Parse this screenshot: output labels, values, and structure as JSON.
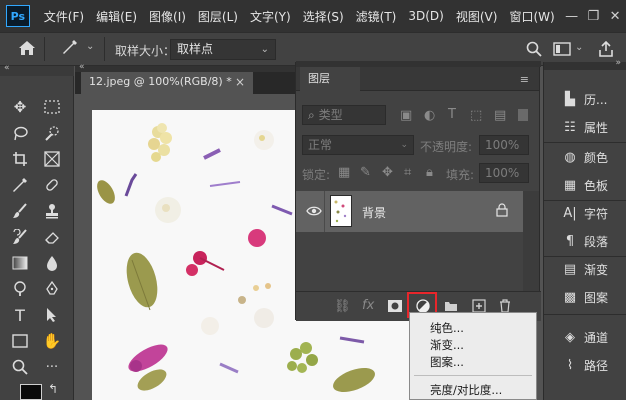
{
  "app": {
    "logo": "Ps",
    "menu": [
      "文件(F)",
      "编辑(E)",
      "图像(I)",
      "图层(L)",
      "文字(Y)",
      "选择(S)",
      "滤镜(T)",
      "3D(D)",
      "视图(V)",
      "窗口(W)"
    ],
    "window_controls": [
      "—",
      "❐",
      "✕"
    ]
  },
  "options": {
    "home_icon": "home-icon",
    "sample_size_label": "取样大小：",
    "sample_size_value": "取样点"
  },
  "document": {
    "tab_title": "12.jpeg @ 100%(RGB/8) *",
    "close": "×"
  },
  "layers_panel": {
    "title": "图层",
    "filter_label": "类型",
    "blend_mode": "正常",
    "opacity_label": "不透明度:",
    "opacity_value": "100%",
    "lock_label": "锁定:",
    "fill_label": "填充:",
    "fill_value": "100%",
    "layer_name": "背景",
    "footer_buttons": [
      "link-icon",
      "fx",
      "mask-icon",
      "adjustment-icon",
      "folder-icon",
      "new-layer-icon",
      "trash-icon"
    ]
  },
  "adjustment_menu": [
    "纯色...",
    "渐变...",
    "图案...",
    "亮度/对比度..."
  ],
  "right_panel": [
    {
      "label": "历...",
      "icon": "history-icon"
    },
    {
      "label": "属性",
      "icon": "properties-icon"
    },
    {
      "label": "颜色",
      "icon": "color-icon"
    },
    {
      "label": "色板",
      "icon": "swatches-icon"
    },
    {
      "label": "字符",
      "icon": "character-icon"
    },
    {
      "label": "段落",
      "icon": "paragraph-icon"
    },
    {
      "label": "渐变",
      "icon": "gradient-icon"
    },
    {
      "label": "图案",
      "icon": "pattern-icon"
    },
    {
      "label": "通道",
      "icon": "channels-icon"
    },
    {
      "label": "路径",
      "icon": "paths-icon"
    }
  ],
  "colors": {
    "accent_highlight": "#e8262b",
    "menubar": "#323232",
    "panel": "#424242",
    "workspace": "#535353"
  }
}
